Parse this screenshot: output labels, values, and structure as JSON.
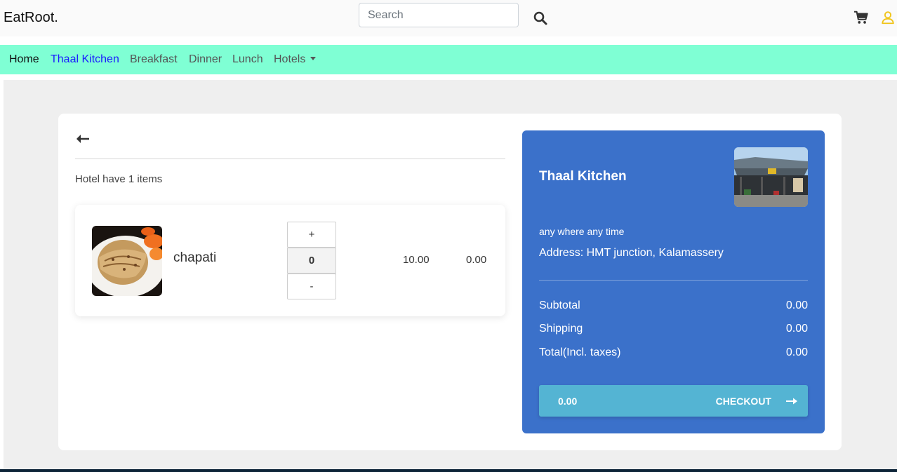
{
  "header": {
    "brand": "EatRoot.",
    "search_placeholder": "Search",
    "icons": [
      "search-icon",
      "cart-icon",
      "user-icon"
    ]
  },
  "nav": {
    "items": [
      {
        "label": "Home"
      },
      {
        "label": "Thaal Kitchen"
      },
      {
        "label": "Breakfast"
      },
      {
        "label": "Dinner"
      },
      {
        "label": "Lunch"
      },
      {
        "label": "Hotels"
      }
    ],
    "active": "Thaal Kitchen"
  },
  "cart": {
    "items_count_text": "Hotel have 1 items",
    "items": [
      {
        "name": "chapati",
        "quantity": "0",
        "price": "10.00",
        "total": "0.00"
      }
    ],
    "plus_label": "+",
    "minus_label": "-"
  },
  "summary": {
    "hotel_name": "Thaal Kitchen",
    "tagline": "any where any time",
    "address": "Address: HMT junction, Kalamassery",
    "rows": [
      {
        "label": "Subtotal",
        "value": "0.00"
      },
      {
        "label": "Shipping",
        "value": "0.00"
      },
      {
        "label": "Total(Incl. taxes)",
        "value": "0.00"
      }
    ],
    "checkout": {
      "amount": "0.00",
      "label": "CHECKOUT"
    }
  },
  "colors": {
    "nav_bg": "#7fffd4",
    "nav_active": "#1a1aff",
    "summary_bg": "#3b71ca",
    "checkout_bg": "#54b4d3",
    "user_icon": "#f0c419"
  }
}
